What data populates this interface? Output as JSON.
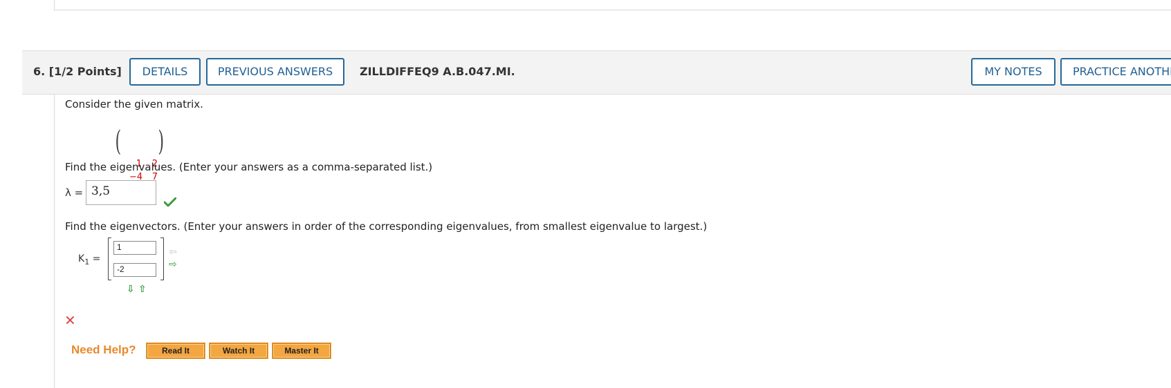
{
  "question": {
    "number_points": "6. [1/2 Points]",
    "buttons": {
      "details": "DETAILS",
      "previous_answers": "PREVIOUS ANSWERS",
      "my_notes": "MY NOTES",
      "practice": "PRACTICE ANOTHER"
    },
    "reference": "ZILLDIFFEQ9 A.B.047.MI."
  },
  "content": {
    "intro": "Consider the given matrix.",
    "matrix": {
      "r1c1": "1",
      "r1c2": "2",
      "r2c1": "−4",
      "r2c2": "7"
    },
    "eigenvalues_prompt": "Find the eigenvalues. (Enter your answers as a comma-separated list.)",
    "lambda_label": "λ =",
    "lambda_value": "3,5",
    "eigenvectors_prompt": "Find the eigenvectors. (Enter your answers in order of the corresponding eigenvalues, from smallest eigenvalue to largest.)",
    "k_label": "K",
    "k_subscript": "1",
    "k_equals": " =",
    "vector": [
      "1",
      "-2"
    ],
    "arrows": {
      "left": "⇦",
      "right": "⇨",
      "down": "⇩",
      "up": "⇧"
    },
    "status": {
      "eigenvalue_result": "correct",
      "eigenvector_result": "incorrect",
      "x_mark": "✕"
    }
  },
  "help": {
    "label": "Need Help?",
    "read_it": "Read It",
    "watch_it": "Watch It",
    "master_it": "Master It"
  },
  "colors": {
    "button_border": "#23689a",
    "matrix_entries": "#cc0000",
    "check": "#3c9a3c",
    "x_mark": "#e04444",
    "need_help": "#e8892b",
    "help_button": "#f4a641"
  }
}
